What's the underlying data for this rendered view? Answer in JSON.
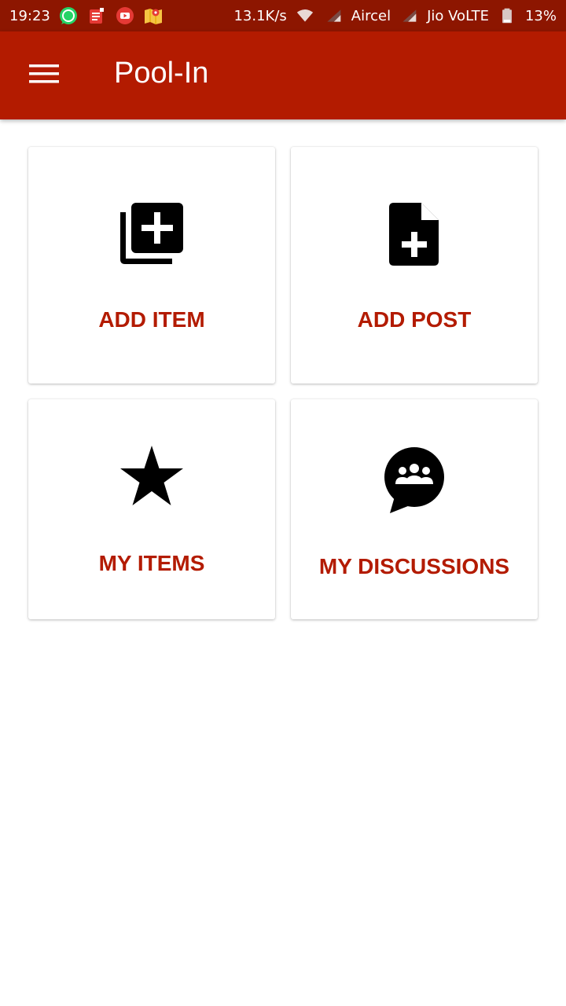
{
  "status_bar": {
    "time": "19:23",
    "speed": "13.1K/s",
    "carrier1": "Aircel",
    "carrier2": "Jio VoLTE",
    "battery": "13%",
    "notification_icons": [
      "whatsapp-icon",
      "news-icon",
      "youtube-icon",
      "maps-icon"
    ]
  },
  "app_bar": {
    "title": "Pool-In",
    "menu_icon": "hamburger-menu-icon"
  },
  "tiles": [
    {
      "label": "ADD ITEM",
      "icon": "library-add-icon"
    },
    {
      "label": "ADD POST",
      "icon": "note-add-icon"
    },
    {
      "label": "MY ITEMS",
      "icon": "star-icon"
    },
    {
      "label": "MY DISCUSSIONS",
      "icon": "group-chat-icon"
    }
  ],
  "colors": {
    "status_bar": "#8d1600",
    "app_bar": "#b31b00",
    "accent_text": "#b31b00",
    "icon": "#000000",
    "background": "#ffffff"
  }
}
